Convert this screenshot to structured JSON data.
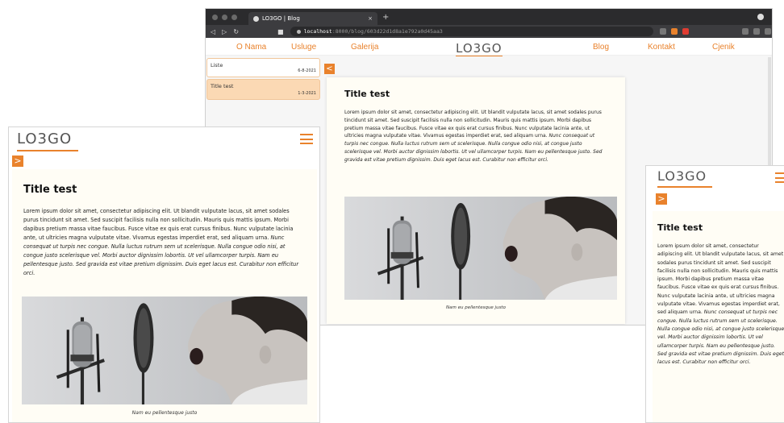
{
  "browser": {
    "tab_title": "LO3GO | Blog",
    "tab_close": "×",
    "new_tab": "+",
    "url_host": "localhost",
    "url_path": ":8000/blog/603d22d1d8a1e792a0d45aa3"
  },
  "site": {
    "logo": "LO3GO",
    "nav": [
      "O Nama",
      "Usluge",
      "Galerija",
      "Blog",
      "Kontakt",
      "Cjenik"
    ],
    "back_glyph": "<",
    "forward_glyph": ">"
  },
  "sidebar": {
    "items": [
      {
        "label": "Liste",
        "date": "6-8-2021"
      },
      {
        "label": "Title test",
        "date": "1-3-2021"
      }
    ]
  },
  "post": {
    "title": "Title test",
    "body_regular": "Lorem ipsum dolor sit amet, consectetur adipiscing elit. Ut blandit vulputate lacus, sit amet sodales purus tincidunt sit amet. Sed suscipit facilisis nulla non sollicitudin. Mauris quis mattis ipsum. Morbi dapibus pretium massa vitae faucibus. Fusce vitae ex quis erat cursus finibus. Nunc vulputate lacinia ante, ut ultricies magna vulputate vitae. Vivamus egestas imperdiet erat, sed aliquam urna.",
    "body_italic": "Nunc consequat ut turpis nec congue. Nulla luctus rutrum sem ut scelerisque. Nulla congue odio nisi, at congue justo scelerisque vel. Morbi auctor dignissim lobortis. Ut vel ullamcorper turpis. Nam eu pellentesque justo. Sed gravida est vitae pretium dignissim. Duis eget lacus est. Curabitur non efficitur orci.",
    "caption": "Nam eu pellentesque justo"
  },
  "colors": {
    "accent": "#e9822c",
    "card_bg": "#fffdf5",
    "active_item": "#fbd9b4"
  }
}
